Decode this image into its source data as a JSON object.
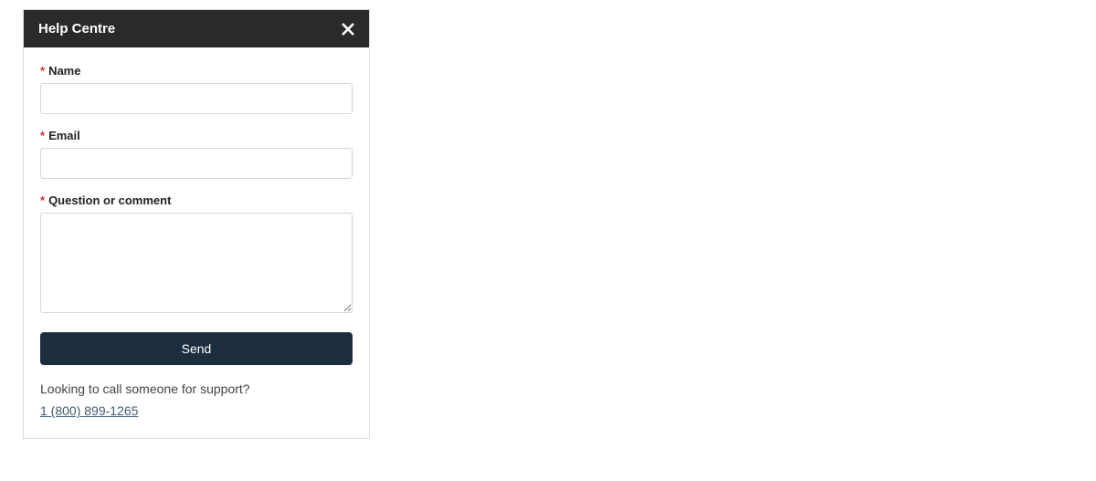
{
  "panel": {
    "title": "Help Centre",
    "required_mark": "*",
    "fields": {
      "name": {
        "label": "Name",
        "value": ""
      },
      "email": {
        "label": "Email",
        "value": ""
      },
      "question": {
        "label": "Question or comment",
        "value": ""
      }
    },
    "send_label": "Send",
    "support_prompt": "Looking to call someone for support?",
    "phone": "1 (800) 899-1265"
  }
}
